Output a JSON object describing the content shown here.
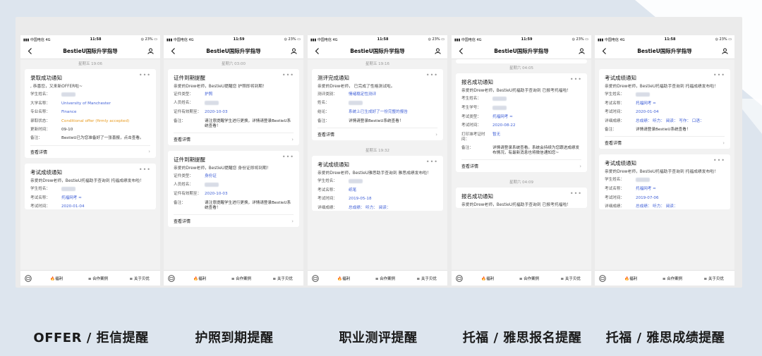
{
  "app_title": "BestieU国际升学指导",
  "tabs": {
    "welfare": "福利",
    "cases": "合作案例",
    "about": "关于贝优"
  },
  "view_details": "查看详情",
  "more": "•••",
  "captions": [
    "OFFER / 拒信提醒",
    "护照到期提醒",
    "职业测评提醒",
    "托福 / 雅思报名提醒",
    "托福 / 雅思成绩提醒"
  ],
  "phones": [
    {
      "status": {
        "carrier": "中国电信 4G",
        "time": "11:58",
        "battery": "◎ 23%"
      },
      "t1": "星期五 19:06",
      "c1": {
        "title": "录取成功通知",
        "intro": ", 恭喜您，又来新OFFER啦~",
        "rows": [
          {
            "lbl": "学生姓名：",
            "val": ""
          },
          {
            "lbl": "大学名称：",
            "val": "University of Manchester"
          },
          {
            "lbl": "专业名称：",
            "val": "Finance"
          },
          {
            "lbl": "录取状态：",
            "val": "Conditional offer (firmly accepted)"
          },
          {
            "lbl": "更新时间：",
            "val": "09-10"
          },
          {
            "lbl": "备注：",
            "val": "BestieU已为您准备好了一张喜报，点击查看。"
          }
        ]
      },
      "c2": {
        "title": "考试成绩通知",
        "intro": "亲爱的Drew老师，BestieU托福助手查询到 托福成绩发布啦！",
        "rows": [
          {
            "lbl": "学生姓名：",
            "val": ""
          },
          {
            "lbl": "考试名称：",
            "val": "托福网考 ≈"
          },
          {
            "lbl": "考试时间：",
            "val": "2020-01-04"
          }
        ]
      }
    },
    {
      "status": {
        "carrier": "中国电信 4G",
        "time": "11:59",
        "battery": "◎ 23%"
      },
      "t1": "星期六 03:00",
      "c1": {
        "title": "证件到期提醒",
        "intro": "亲爱的Drew老师，BestieU提醒您 护照即将到期！",
        "rows": [
          {
            "lbl": "证件类型：",
            "val": "护照"
          },
          {
            "lbl": "人员姓名：",
            "val": ""
          },
          {
            "lbl": "证件有效期至：",
            "val": "2020-10-03"
          },
          {
            "lbl": "备注：",
            "val": "请注意提醒学生进行更换，详情请登录BestieU系统查看！"
          }
        ]
      },
      "c2": {
        "title": "证件到期提醒",
        "intro": "亲爱的Drew老师，BestieU提醒您 身份证即将到期！",
        "rows": [
          {
            "lbl": "证件类型：",
            "val": "身份证"
          },
          {
            "lbl": "人员姓名：",
            "val": ""
          },
          {
            "lbl": "证件有效期至：",
            "val": "2020-10-03"
          },
          {
            "lbl": "备注：",
            "val": "请注意提醒学生进行更换，详情请登录BestieU系统查看！"
          }
        ]
      }
    },
    {
      "status": {
        "carrier": "中国电信 4G",
        "time": "11:58",
        "battery": "◎ 23%"
      },
      "t1": "星期五 19:16",
      "c1": {
        "title": "测评完成通知",
        "intro": "亲爱的Drew老师， 已完成了性格测试啦。",
        "rows": [
          {
            "lbl": "测评类别：",
            "val": "情绪稳定性测评"
          },
          {
            "lbl": "姓名：",
            "val": ""
          },
          {
            "lbl": "结论：",
            "val": "系统上已生成好了一份完整的报告"
          },
          {
            "lbl": "备注：",
            "val": "详情请登录BestieU系统查看！"
          }
        ]
      },
      "t2": "星期五 19:32",
      "c2": {
        "title": "考试成绩通知",
        "intro": "亲爱的Drew老师，BestieU雅思助手查询到 雅思成绩发布啦！",
        "rows": [
          {
            "lbl": "学生姓名：",
            "val": ""
          },
          {
            "lbl": "考试名称：",
            "val": "纸笔"
          },
          {
            "lbl": "考试时间：",
            "val": "2019-05-18"
          },
          {
            "lbl": "详细成绩：",
            "val": "总成绩： 听力： 阅读："
          }
        ]
      }
    },
    {
      "status": {
        "carrier": "中国电信 4G",
        "time": "11:59",
        "battery": "◎ 23%"
      },
      "t1": "星期六 04:05",
      "c1": {
        "title": "报名成功通知",
        "intro": "亲爱的Drew老师，BestieU托福助手查询到 已报考托福啦！",
        "rows": [
          {
            "lbl": "考生姓名：",
            "val": ""
          },
          {
            "lbl": "考生学号：",
            "val": ""
          },
          {
            "lbl": "考试类型：",
            "val": "托福网考 ≈"
          },
          {
            "lbl": "考试时间：",
            "val": "2020-08-22"
          },
          {
            "lbl": "打印准考证时间：",
            "val": "暂无"
          },
          {
            "lbl": "备注：",
            "val": "详情请登录系统查看。系统会持续为您跟进成绩发布情况，有最新消息也将微信通知您~"
          }
        ]
      },
      "t2": "星期六 04:09",
      "c2": {
        "title": "报名成功通知",
        "intro": "亲爱的Drew老师，BestieU托福助手查询到 已报考托福啦！",
        "rows": []
      }
    },
    {
      "status": {
        "carrier": "中国电信 4G",
        "time": "11:58",
        "battery": "◎ 23%"
      },
      "c1": {
        "title": "考试成绩通知",
        "intro": "亲爱的Drew老师，BestieU托福助手查询到 托福成绩发布啦！",
        "rows": [
          {
            "lbl": "学生姓名：",
            "val": ""
          },
          {
            "lbl": "考试名称：",
            "val": "托福网考 ≈"
          },
          {
            "lbl": "考试时间：",
            "val": "2020-01-04"
          },
          {
            "lbl": "详细成绩：",
            "val": "总成绩： 听力： 阅读： 写作： 口语："
          },
          {
            "lbl": "备注：",
            "val": "详情请登录BestieU系统查看！"
          }
        ]
      },
      "c2": {
        "title": "考试成绩通知",
        "intro": "亲爱的Drew老师，BestieU托福助手查询到 托福成绩发布啦！",
        "rows": [
          {
            "lbl": "学生姓名：",
            "val": ""
          },
          {
            "lbl": "考试名称：",
            "val": "托福网考 ≈"
          },
          {
            "lbl": "考试时间：",
            "val": "2019-07-06"
          },
          {
            "lbl": "详细成绩：",
            "val": "总成绩： 听力： 阅读："
          }
        ]
      }
    }
  ]
}
